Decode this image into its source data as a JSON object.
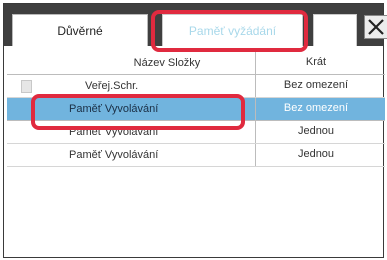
{
  "tabs": {
    "trusted": "Důvěrné",
    "recall_memory": "Paměť vyžádání"
  },
  "table": {
    "header": {
      "name": "Název Složky",
      "times": "Krát"
    },
    "rows": [
      {
        "name": "Veřej.Schr.",
        "times": "Bez omezení",
        "icon": "document-icon",
        "selected": false
      },
      {
        "name": "Paměť Vyvolávání",
        "times": "Bez omezení",
        "selected": true
      },
      {
        "name": "Paměť Vyvolávání",
        "times": "Jednou",
        "selected": false
      },
      {
        "name": "Paměť Vyvolávání",
        "times": "Jednou",
        "selected": false
      }
    ]
  },
  "close_icon": "close-icon",
  "colors": {
    "tab_bar": "#3f3f3f",
    "selected_row": "#71b4de",
    "highlight": "#e02a3f",
    "inactive_tab_text": "#a8d8ea"
  }
}
